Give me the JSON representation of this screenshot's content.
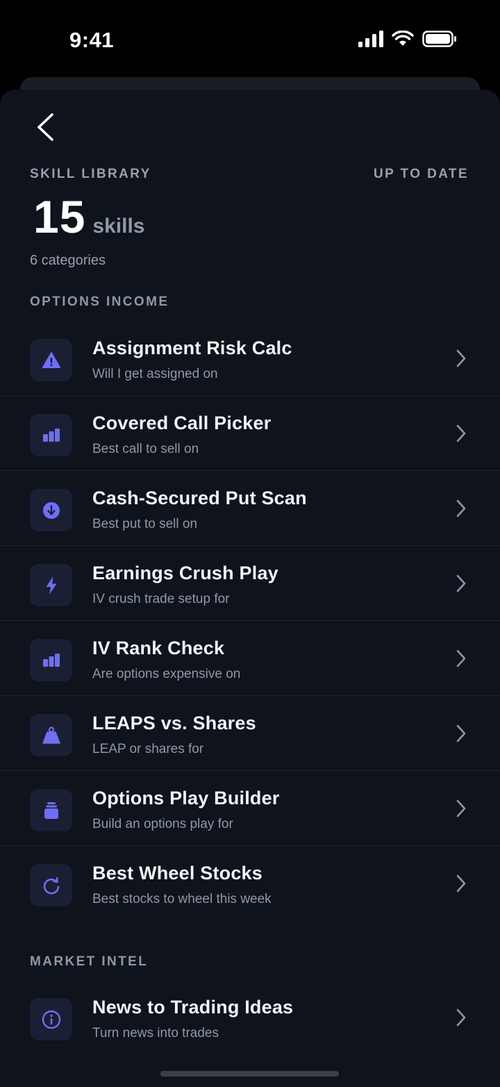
{
  "status_bar": {
    "time": "9:41"
  },
  "header": {
    "eyebrow": "SKILL LIBRARY",
    "status": "UP TO DATE",
    "count": "15",
    "count_unit": "skills",
    "categories": "6 categories"
  },
  "sections": [
    {
      "label": "OPTIONS INCOME",
      "items": [
        {
          "title": "Assignment Risk Calc",
          "subtitle": "Will I get assigned on",
          "icon": "warning-icon"
        },
        {
          "title": "Covered Call Picker",
          "subtitle": "Best call to sell on",
          "icon": "bar-chart-icon"
        },
        {
          "title": "Cash-Secured Put Scan",
          "subtitle": "Best put to sell on",
          "icon": "arrow-down-circle-icon"
        },
        {
          "title": "Earnings Crush Play",
          "subtitle": "IV crush trade setup for",
          "icon": "lightning-icon"
        },
        {
          "title": "IV Rank Check",
          "subtitle": "Are options expensive on",
          "icon": "bar-chart-icon"
        },
        {
          "title": "LEAPS vs. Shares",
          "subtitle": "LEAP or shares for",
          "icon": "weight-icon"
        },
        {
          "title": "Options Play Builder",
          "subtitle": "Build an options play for",
          "icon": "stack-icon"
        },
        {
          "title": "Best Wheel Stocks",
          "subtitle": "Best stocks to wheel this week",
          "icon": "refresh-icon"
        }
      ]
    },
    {
      "label": "MARKET INTEL",
      "items": [
        {
          "title": "News to Trading Ideas",
          "subtitle": "Turn news into trades",
          "icon": "info-icon"
        }
      ]
    }
  ],
  "colors": {
    "accent": "#6f6ef5",
    "background": "#0e131c",
    "tile": "#1a1f33"
  }
}
